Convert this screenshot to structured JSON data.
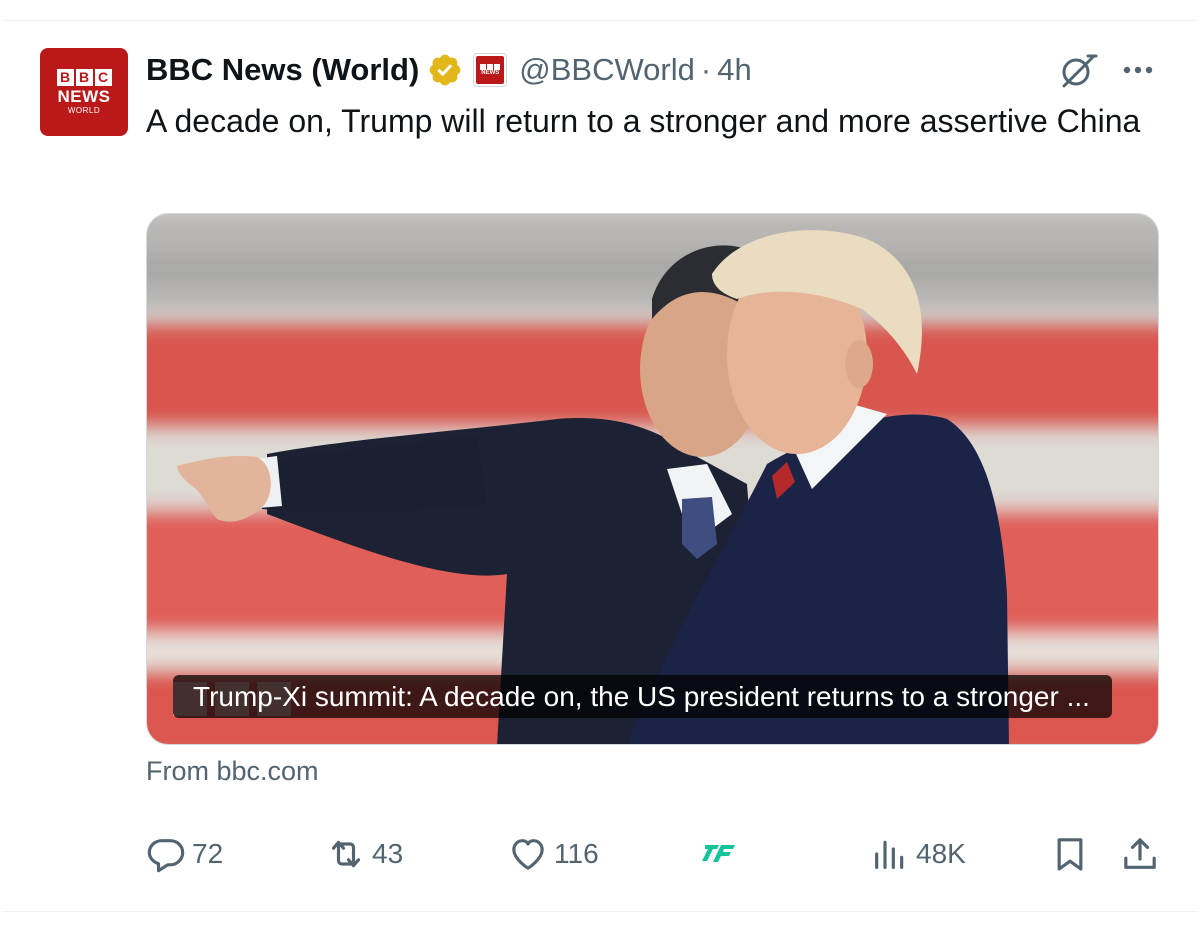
{
  "account": {
    "avatar": {
      "bbc_letters": [
        "B",
        "B",
        "C"
      ],
      "news": "NEWS",
      "world": "WORLD"
    },
    "name": "BBC News (World)",
    "handle": "@BBCWorld",
    "separator": "·",
    "time": "4h",
    "verified_color": "#e2b719"
  },
  "tweet": {
    "text": "A decade on, Trump will return to a stronger and more assertive China"
  },
  "card": {
    "title": "Trump-Xi summit: A decade on, the US president returns to a stronger ...",
    "source": "From bbc.com"
  },
  "actions": {
    "replies": "72",
    "reposts": "43",
    "likes": "116",
    "views": "48K"
  },
  "colors": {
    "bbc_red": "#bb1919",
    "text_primary": "#0f1419",
    "text_secondary": "#536471",
    "tweetfull_green": "#14c49b"
  },
  "icons": [
    "verified-badge-icon",
    "affiliate-badge-icon",
    "grok-icon",
    "more-icon",
    "reply-icon",
    "repost-icon",
    "like-icon",
    "tweetfull-icon",
    "views-icon",
    "bookmark-icon",
    "share-icon"
  ]
}
